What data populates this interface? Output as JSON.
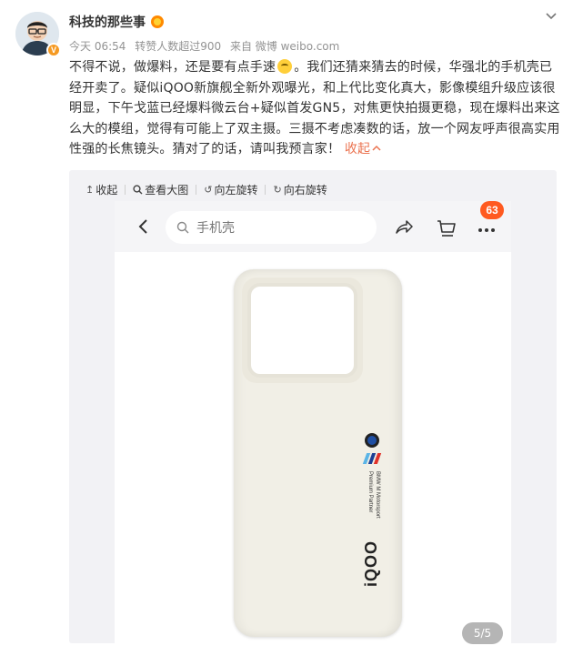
{
  "post": {
    "username": "科技的那些事",
    "meta": {
      "time": "今天 06:54",
      "likes": "转赞人数超过900",
      "source": "来自 微博 weibo.com"
    },
    "text_part1": "不得不说，做爆料，还是要有点手速",
    "text_part2": "。我们还猜来猜去的时候，华强北的手机壳已经开卖了。疑似iQOO新旗舰全新外观曝光，和上代比变化真大，影像模组升级应该很明显，下午戈蓝已经爆料微云台+疑似首发GN5，对焦更快拍摄更稳，现在爆料出来这么大的模组，觉得有可能上了双主摄。三摄不考虑凑数的话，放一个网友呼声很高实用性强的长焦镜头。猜对了的话，请叫我预言家！",
    "collapse_label": "收起",
    "verified_badge": "V"
  },
  "media": {
    "toolbar": {
      "collapse": "收起",
      "view_large": "查看大图",
      "rotate_left": "向左旋转",
      "rotate_right": "向右旋转"
    },
    "app": {
      "search_placeholder": "手机壳",
      "cart_badge": "63",
      "phone_partner_text": "BMW M Motorsport Premium Partner",
      "brand_text": "iQOO"
    },
    "page_counter": "5/5"
  },
  "colors": {
    "link": "#eb7350",
    "badge": "#ff5a20",
    "verified": "#f59a23"
  }
}
